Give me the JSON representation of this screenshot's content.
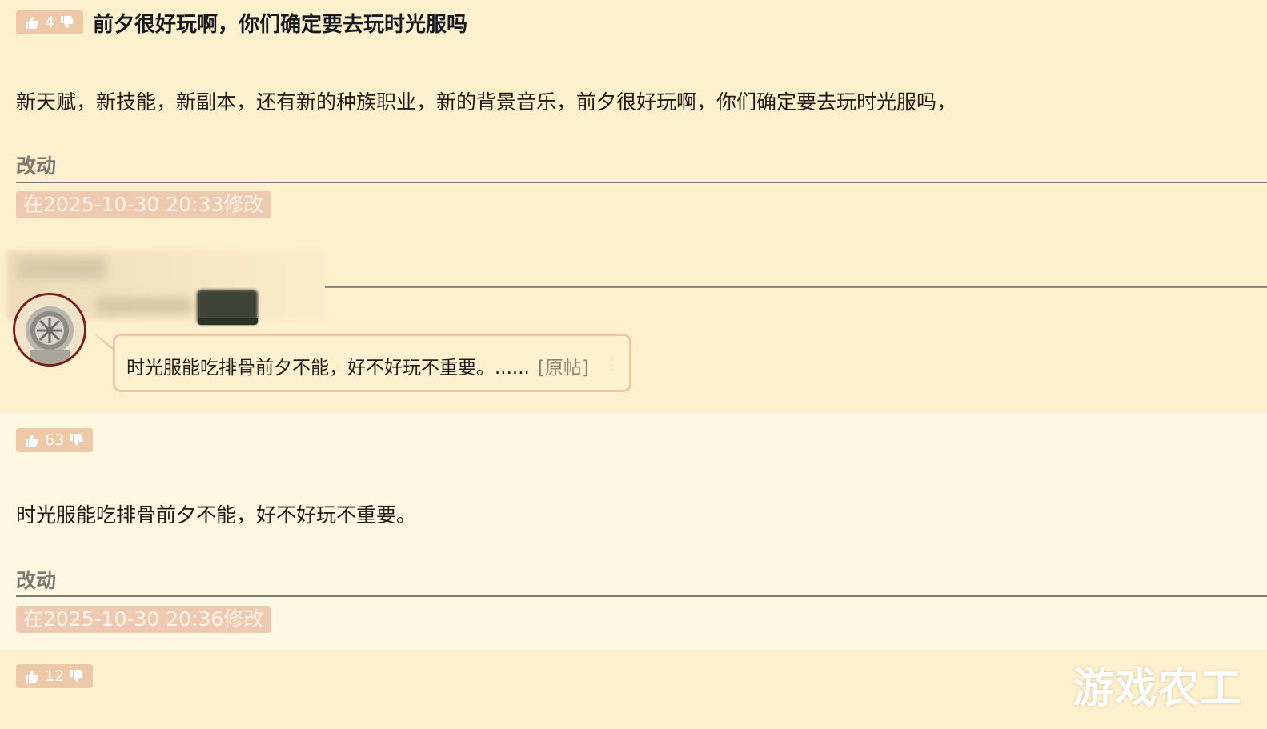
{
  "post1": {
    "votes": "4",
    "title": "前夕很好玩啊，你们确定要去玩时光服吗",
    "body": "新天赋，新技能，新副本，还有新的种族职业，新的背景音乐，前夕很好玩啊，你们确定要去玩时光服吗，",
    "edit_heading": "改动",
    "edit_stamp": "在2025-10-30 20:33修改"
  },
  "reply": {
    "avatar_icon": "diving-helmet-avatar-icon",
    "quote_text": "时光服能吃排骨前夕不能，好不好玩不重要。......",
    "original_link": "[原帖]",
    "menu_icon": "vertical-dots-icon"
  },
  "post2": {
    "votes": "63",
    "body": "时光服能吃排骨前夕不能，好不好玩不重要。",
    "edit_heading": "改动",
    "edit_stamp": "在2025-10-30 20:36修改"
  },
  "post3": {
    "votes": "12"
  },
  "watermark": "游戏农工",
  "colors": {
    "background": "#fdf0cc",
    "alt_background": "#fef7e2",
    "vote_badge": "#edc9a8",
    "quote_border": "#eec6a6",
    "avatar_ring": "#7a1f17"
  }
}
